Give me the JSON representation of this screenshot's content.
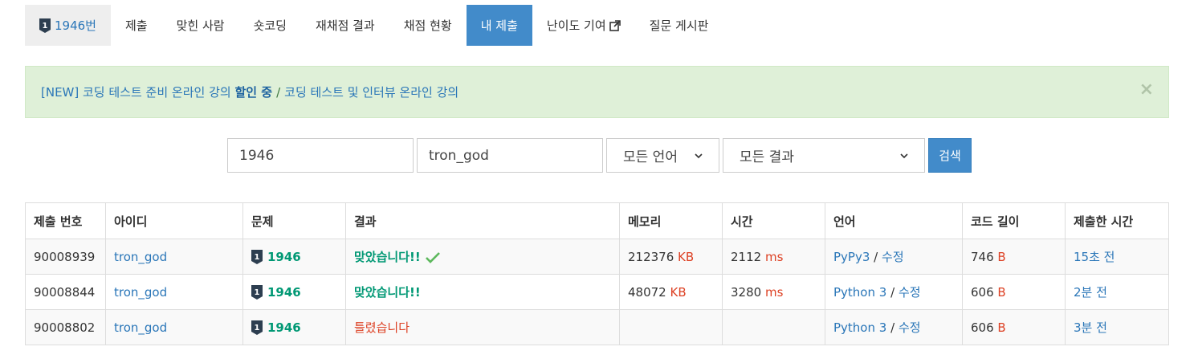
{
  "tabs": [
    {
      "label": "1946번",
      "active": false
    },
    {
      "label": "제출",
      "active": false
    },
    {
      "label": "맞힌 사람",
      "active": false
    },
    {
      "label": "숏코딩",
      "active": false
    },
    {
      "label": "재채점 결과",
      "active": false
    },
    {
      "label": "채점 현황",
      "active": false
    },
    {
      "label": "내 제출",
      "active": true
    },
    {
      "label": "난이도 기여",
      "active": false
    },
    {
      "label": "질문 게시판",
      "active": false
    }
  ],
  "alert": {
    "text1": "[NEW] 코딩 테스트 준비 온라인 강의",
    "bold": "할인 중",
    "separator": "/",
    "text2": "코딩 테스트 및 인터뷰 온라인 강의",
    "close": "×"
  },
  "search": {
    "problem_value": "1946",
    "user_value": "tron_god",
    "language": "모든 언어",
    "result": "모든 결과",
    "button": "검색"
  },
  "table": {
    "headers": [
      "제출 번호",
      "아이디",
      "문제",
      "결과",
      "메모리",
      "시간",
      "언어",
      "코드 길이",
      "제출한 시간"
    ],
    "rows": [
      {
        "id": "90008939",
        "user": "tron_god",
        "problem": "1946",
        "result": "맞았습니다!!",
        "memory": "212376",
        "memory_unit": "KB",
        "time": "2112",
        "time_unit": "ms",
        "language": "PyPy3",
        "edit": "수정",
        "code_length": "746",
        "code_unit": "B",
        "submitted": "15초 전"
      },
      {
        "id": "90008844",
        "user": "tron_god",
        "problem": "1946",
        "result": "맞았습니다!!",
        "memory": "48072",
        "memory_unit": "KB",
        "time": "3280",
        "time_unit": "ms",
        "language": "Python 3",
        "edit": "수정",
        "code_length": "606",
        "code_unit": "B",
        "submitted": "2분 전"
      },
      {
        "id": "90008802",
        "user": "tron_god",
        "problem": "1946",
        "result": "틀렸습니다",
        "memory": "",
        "memory_unit": "",
        "time": "",
        "time_unit": "",
        "language": "Python 3",
        "edit": "수정",
        "code_length": "606",
        "code_unit": "B",
        "submitted": "3분 전"
      }
    ]
  },
  "colors": {
    "accent": "#428bca",
    "success": "#009874",
    "danger": "#dd4124",
    "alert_bg": "#dff0d8"
  }
}
